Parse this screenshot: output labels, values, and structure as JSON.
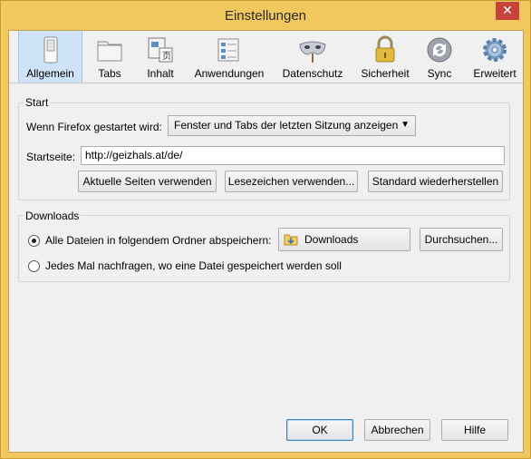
{
  "window": {
    "title": "Einstellungen",
    "close_glyph": "✕"
  },
  "toolbar": {
    "panes": [
      {
        "label": "Allgemein",
        "icon": "general-switch-icon",
        "selected": true
      },
      {
        "label": "Tabs",
        "icon": "tabs-folder-icon",
        "selected": false
      },
      {
        "label": "Inhalt",
        "icon": "content-document-icon",
        "selected": false
      },
      {
        "label": "Anwendungen",
        "icon": "applications-list-icon",
        "selected": false
      },
      {
        "label": "Datenschutz",
        "icon": "privacy-mask-icon",
        "selected": false
      },
      {
        "label": "Sicherheit",
        "icon": "security-padlock-icon",
        "selected": false
      },
      {
        "label": "Sync",
        "icon": "sync-arrows-icon",
        "selected": false
      },
      {
        "label": "Erweitert",
        "icon": "advanced-gear-icon",
        "selected": false
      }
    ]
  },
  "start": {
    "caption": "Start",
    "startup_label": "Wenn Firefox gestartet wird:",
    "startup_value": "Fenster und Tabs der letzten Sitzung anzeigen",
    "homepage_label": "Startseite:",
    "homepage_value": "http://geizhals.at/de/",
    "use_current_button": "Aktuelle Seiten verwenden",
    "use_bookmark_button": "Lesezeichen verwenden...",
    "restore_default_button": "Standard wiederherstellen"
  },
  "downloads": {
    "caption": "Downloads",
    "save_to_label": "Alle Dateien in folgendem Ordner abspeichern:",
    "folder_value": "Downloads",
    "browse_button": "Durchsuchen...",
    "ask_label": "Jedes Mal nachfragen, wo eine Datei gespeichert werden soll",
    "save_to_checked": true
  },
  "footer": {
    "ok": "OK",
    "cancel": "Abbrechen",
    "help": "Hilfe"
  },
  "colors": {
    "frame": "#f0c760",
    "close": "#c7443c",
    "selected_pane": "#cfe3f8"
  }
}
